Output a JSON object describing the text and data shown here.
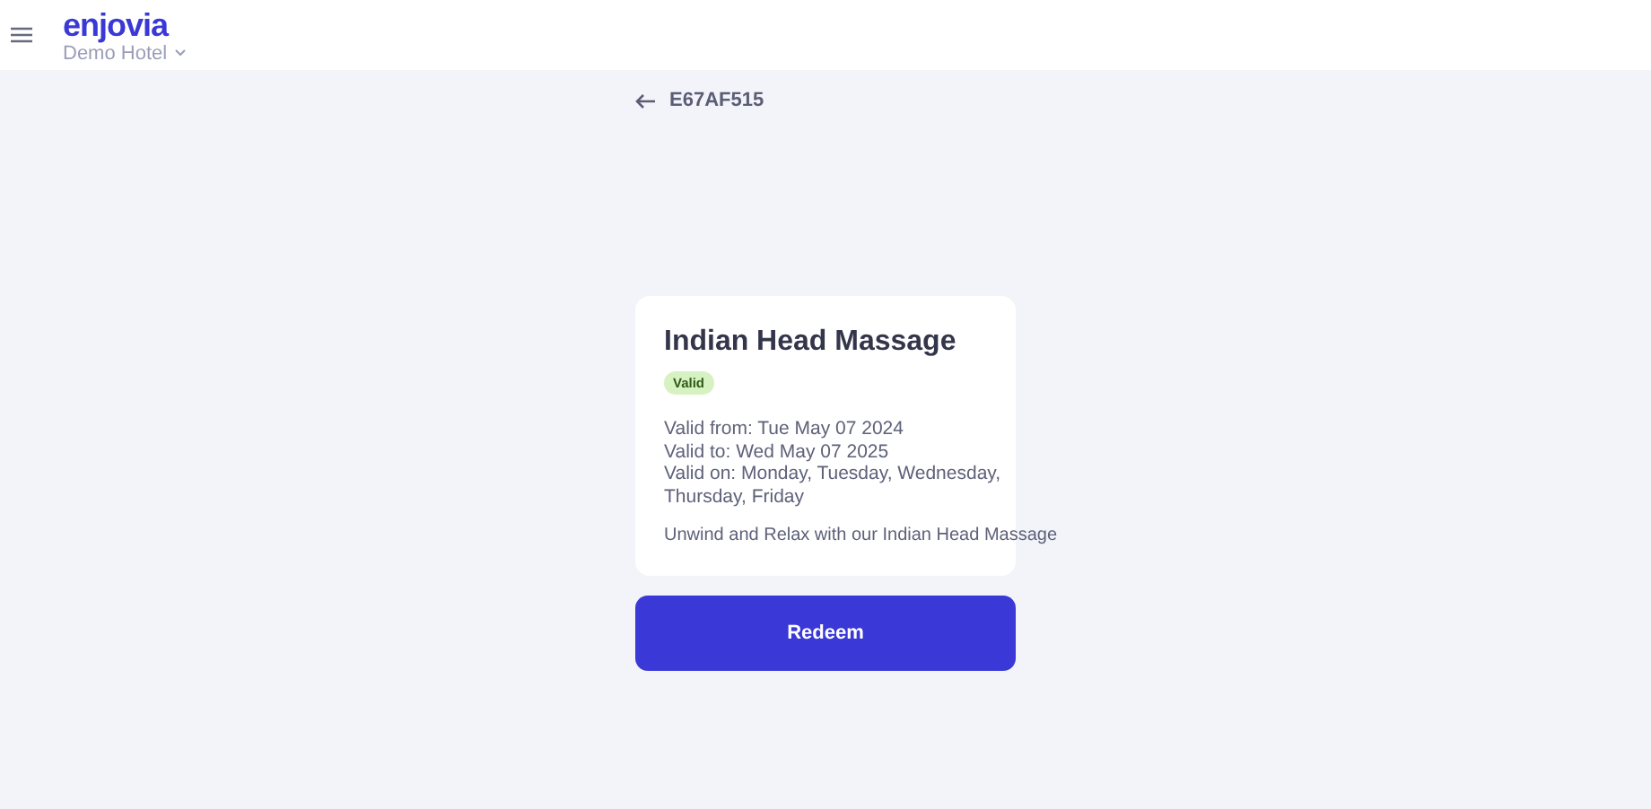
{
  "header": {
    "logo": "enjovia",
    "property": "Demo Hotel"
  },
  "voucher_code": "E67AF515",
  "card": {
    "title": "Indian Head Massage",
    "status": {
      "label": "Valid",
      "kind": "valid"
    },
    "details": [
      "Valid from: Tue May 07 2024",
      "Valid to: Wed May 07 2025",
      "Valid on: Monday, Tuesday, Wednesday, Thursday, Friday"
    ],
    "description": "Unwind and Relax with our Indian Head Massage"
  },
  "action": "Redeem"
}
